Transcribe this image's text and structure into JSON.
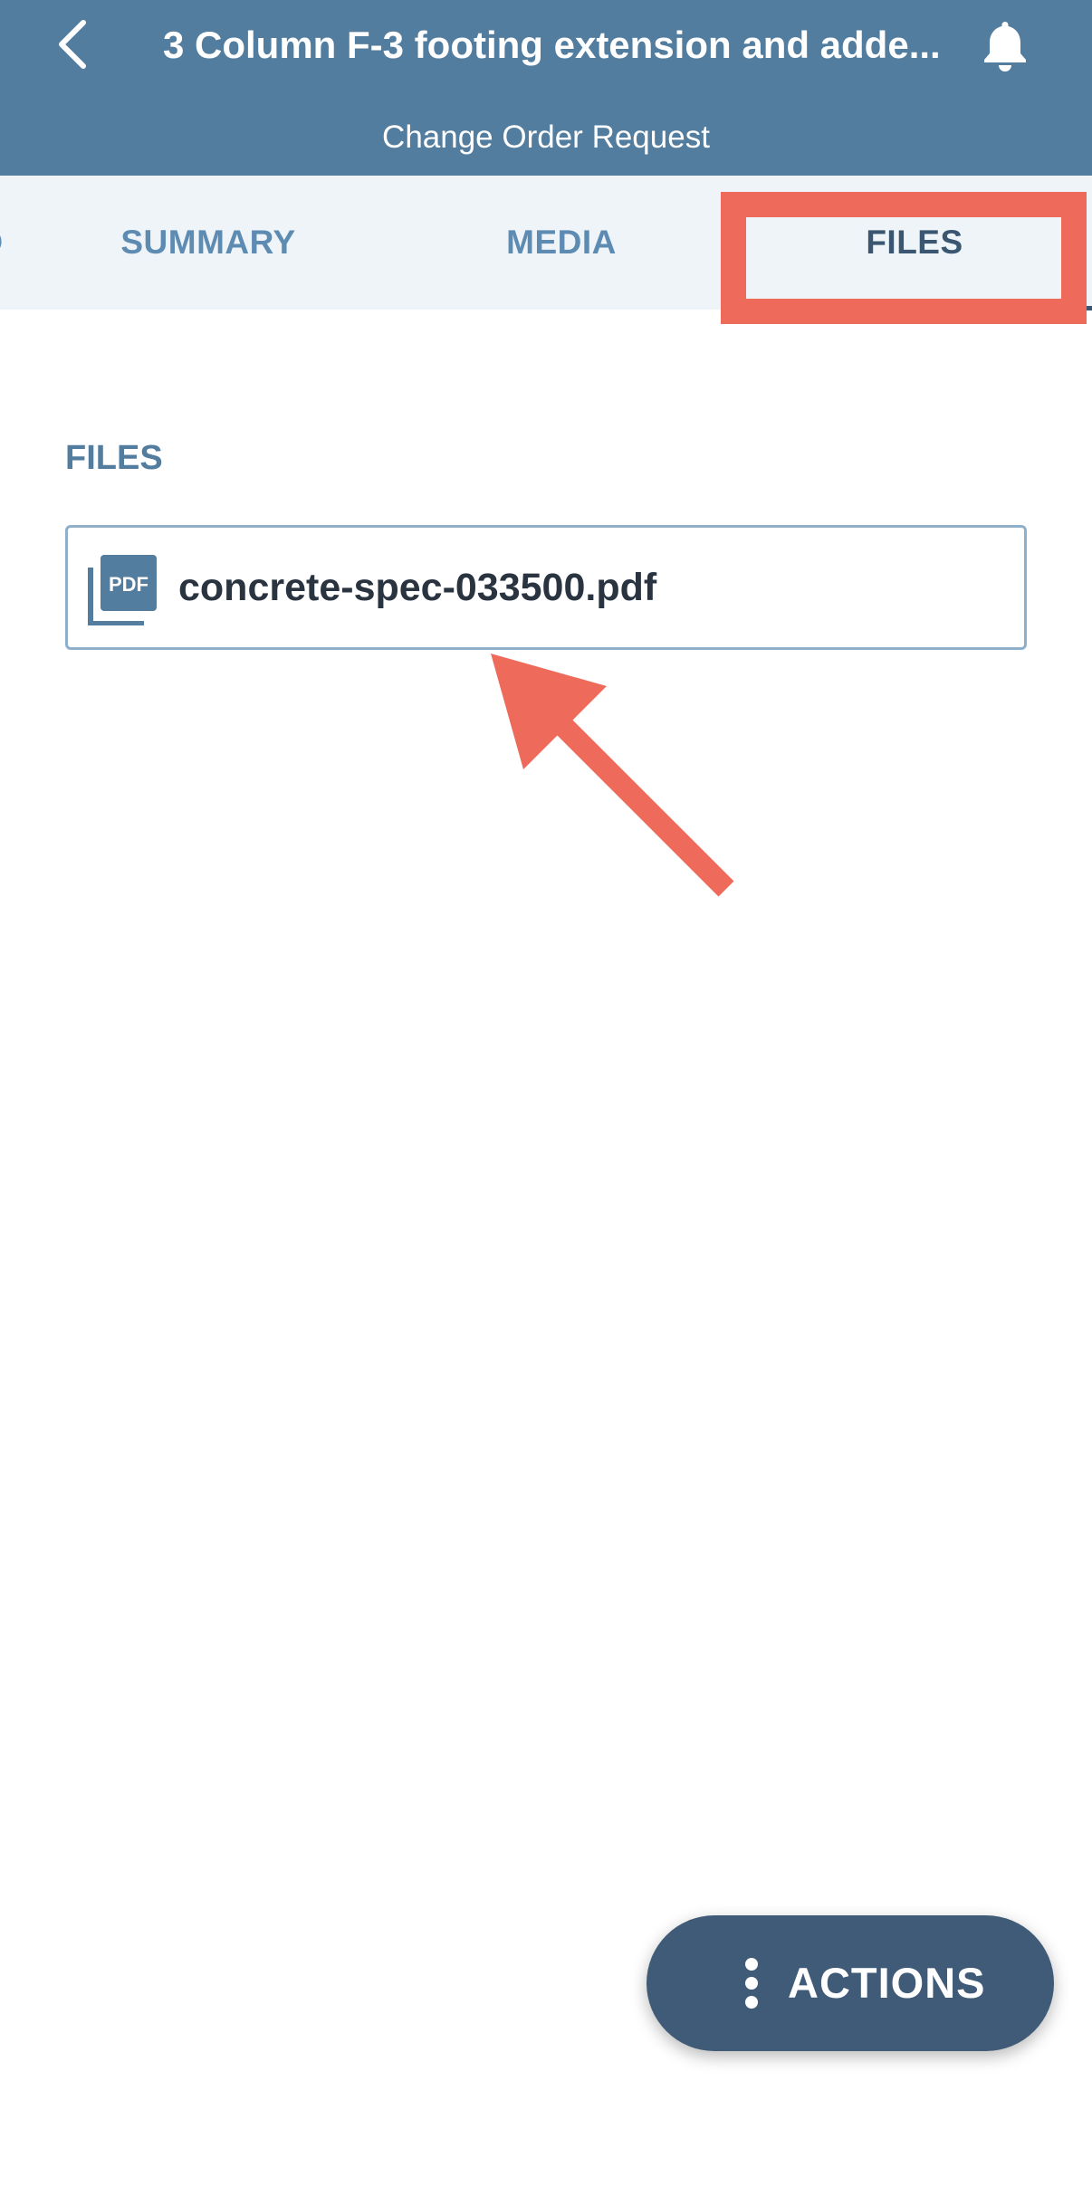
{
  "header": {
    "title": "3 Column F-3 footing extension and adde...",
    "subtitle": "Change Order Request",
    "back_icon": "chevron-left-icon",
    "notification_icon": "bell-icon"
  },
  "tabs": [
    {
      "label": "D",
      "active": false
    },
    {
      "label": "SUMMARY",
      "active": false
    },
    {
      "label": "MEDIA",
      "active": false
    },
    {
      "label": "FILES",
      "active": true
    }
  ],
  "files_section": {
    "label": "FILES",
    "items": [
      {
        "name": "concrete-spec-033500.pdf",
        "icon": "pdf-icon",
        "icon_text": "PDF"
      }
    ]
  },
  "actions_button": {
    "label": "ACTIONS",
    "icon": "more-vertical-icon"
  },
  "colors": {
    "header_bg": "#537d9f",
    "tab_bar_bg": "#eff4f8",
    "tab_text": "#5e8bb2",
    "tab_text_active": "#3a5670",
    "annotation": "#ee6a5a",
    "actions_bg": "#3f5b77"
  }
}
